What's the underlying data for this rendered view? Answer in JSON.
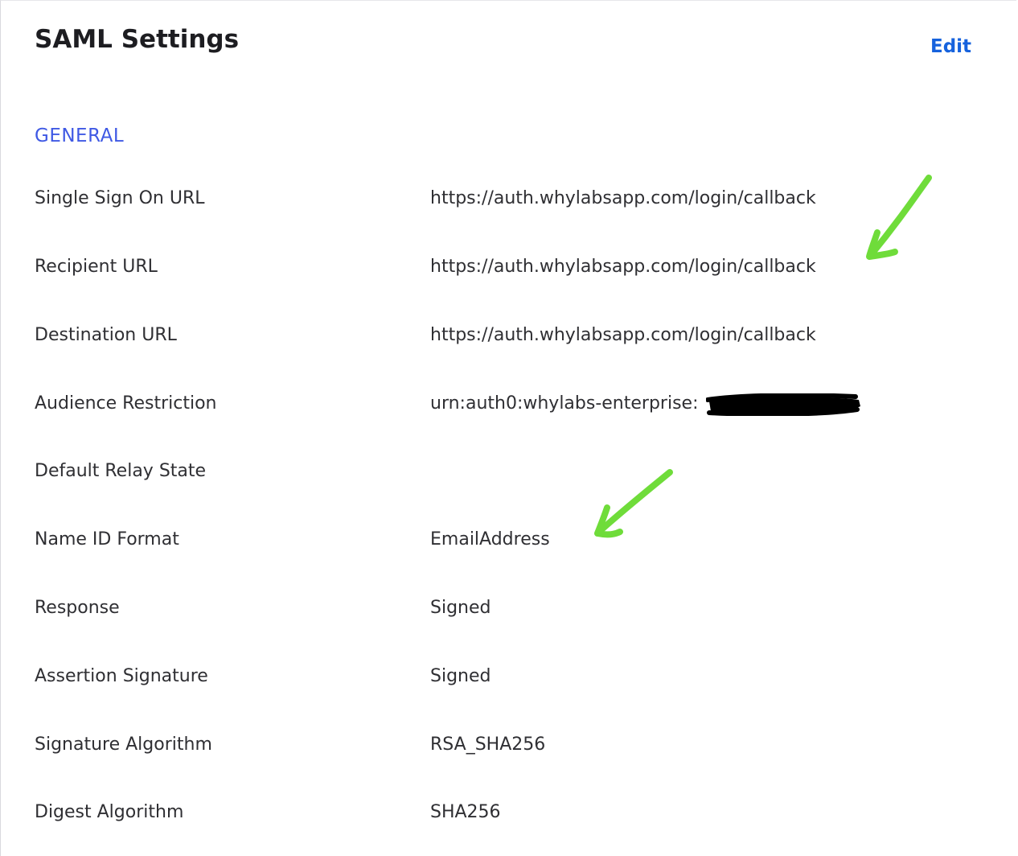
{
  "panel": {
    "title": "SAML Settings",
    "edit_label": "Edit"
  },
  "general": {
    "section_title": "GENERAL",
    "rows": [
      {
        "label": "Single Sign On URL",
        "value": "https://auth.whylabsapp.com/login/callback"
      },
      {
        "label": "Recipient URL",
        "value": "https://auth.whylabsapp.com/login/callback"
      },
      {
        "label": "Destination URL",
        "value": "https://auth.whylabsapp.com/login/callback"
      },
      {
        "label": "Audience Restriction",
        "value": "urn:auth0:whylabs-enterprise:"
      },
      {
        "label": "Default Relay State",
        "value": ""
      },
      {
        "label": "Name ID Format",
        "value": "EmailAddress"
      },
      {
        "label": "Response",
        "value": "Signed"
      },
      {
        "label": "Assertion Signature",
        "value": "Signed"
      },
      {
        "label": "Signature Algorithm",
        "value": "RSA_SHA256"
      },
      {
        "label": "Digest Algorithm",
        "value": "SHA256"
      }
    ]
  },
  "colors": {
    "accent_link": "#1662dd",
    "section_header": "#3f59e4",
    "annotation_arrow": "#6fdc3a",
    "redaction": "#000000"
  },
  "icons": {
    "annotation": "hand-drawn-arrow-icon",
    "redaction": "redaction-mark"
  }
}
